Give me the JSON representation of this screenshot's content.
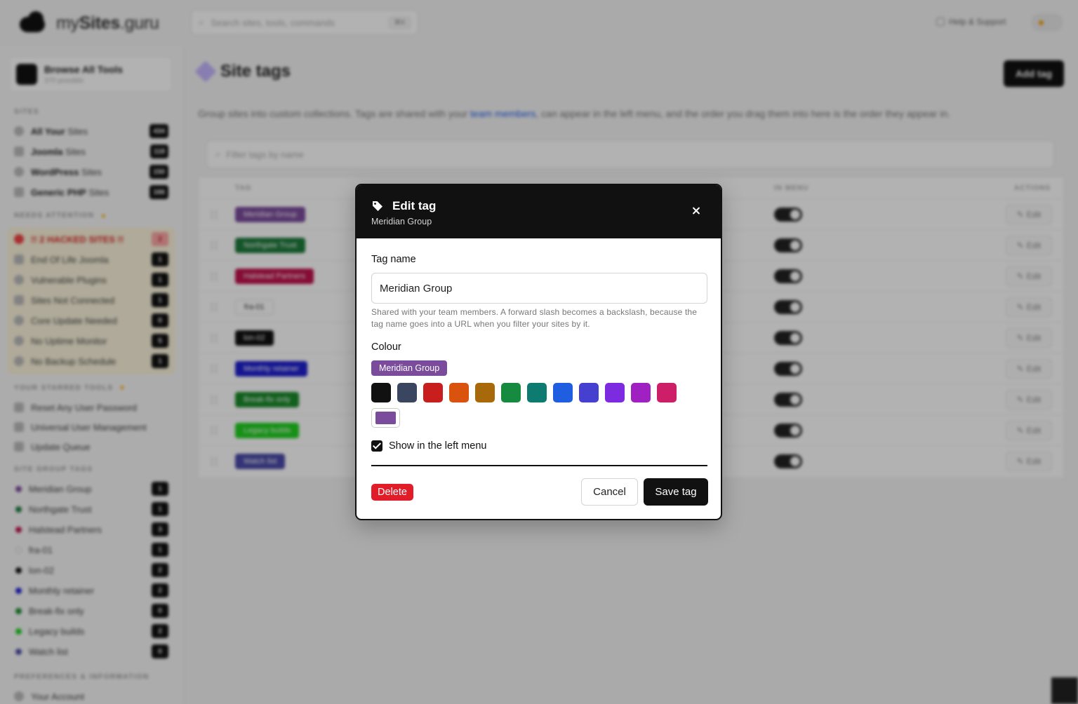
{
  "app": {
    "logo_text_light": "my",
    "logo_text_bold": "Sites",
    "logo_text_tail": ".guru",
    "search_placeholder": "Search sites, tools, commands",
    "search_kbd": "⌘K",
    "help_label": "Help & Support"
  },
  "sidebar": {
    "browse_title": "Browse All Tools",
    "browse_sub": "370 possible",
    "sites_label": "SITES",
    "sites": [
      {
        "bold": "All Your",
        "rest": " Sites",
        "count": "434"
      },
      {
        "bold": "Joomla",
        "rest": " Sites",
        "count": "118"
      },
      {
        "bold": "WordPress",
        "rest": " Sites",
        "count": "150"
      },
      {
        "bold": "Generic PHP",
        "rest": " Sites",
        "count": "166"
      }
    ],
    "attention_label": "NEEDS ATTENTION",
    "attention": [
      {
        "label": "!! 2 HACKED SITES !!",
        "count": "2"
      },
      {
        "label": "End Of Life Joomla",
        "count": "1"
      },
      {
        "label": "Vulnerable Plugins",
        "count": "1"
      },
      {
        "label": "Sites Not Connected",
        "count": "1"
      },
      {
        "label": "Core Update Needed",
        "count": "0"
      },
      {
        "label": "No Uptime Monitor",
        "count": "5"
      },
      {
        "label": "No Backup Schedule",
        "count": "1"
      }
    ],
    "starred_label": "YOUR STARRED TOOLS",
    "starred": [
      "Reset Any User Password",
      "Universal User Management",
      "Update Queue"
    ],
    "groups_label": "SITE GROUP TAGS",
    "groups": [
      {
        "label": "Meridian Group",
        "count": "1",
        "color": "#7b4c9c"
      },
      {
        "label": "Northgate Trust",
        "count": "1",
        "color": "#1e7a3c"
      },
      {
        "label": "Halstead Partners",
        "count": "3",
        "color": "#c0134d"
      },
      {
        "label": "fra-01",
        "count": "1",
        "color": "#ffffff"
      },
      {
        "label": "lon-02",
        "count": "2",
        "color": "#111111"
      },
      {
        "label": "Monthly retainer",
        "count": "2",
        "color": "#2020d0"
      },
      {
        "label": "Break-fix only",
        "count": "0",
        "color": "#1a8a2a"
      },
      {
        "label": "Legacy builds",
        "count": "2",
        "color": "#20d020"
      },
      {
        "label": "Watch list",
        "count": "0",
        "color": "#4a4aa8"
      }
    ],
    "prefs_label": "PREFERENCES & INFORMATION",
    "account_label": "Your Account"
  },
  "main": {
    "title": "Site tags",
    "add_button": "Add tag",
    "desc_before": "Group sites into custom collections. Tags are shared with your ",
    "desc_link": "team members",
    "desc_after": ", can appear in the left menu, and the order you drag them into here is the order they appear in.",
    "filter_placeholder": "Filter tags by name",
    "col_tag": "TAG",
    "col_menu": "IN MENU",
    "col_actions": "ACTIONS",
    "edit_label": "Edit",
    "rows": [
      {
        "label": "Meridian Group",
        "color": "#7b4c9c"
      },
      {
        "label": "Northgate Trust",
        "color": "#1e7a3c"
      },
      {
        "label": "Halstead Partners",
        "color": "#c0134d"
      },
      {
        "label": "fra-01",
        "color": "#ffffff"
      },
      {
        "label": "lon-02",
        "color": "#111111"
      },
      {
        "label": "Monthly retainer",
        "color": "#2020d0"
      },
      {
        "label": "Break-fix only",
        "color": "#1a8a2a"
      },
      {
        "label": "Legacy builds",
        "color": "#20d020"
      },
      {
        "label": "Watch list",
        "color": "#4a4aa8"
      }
    ]
  },
  "modal": {
    "title": "Edit tag",
    "subtitle": "Meridian Group",
    "name_label": "Tag name",
    "name_value": "Meridian Group",
    "hint": "Shared with your team members. A forward slash becomes a backslash, because the tag name goes into a URL when you filter your sites by it.",
    "colour_label": "Colour",
    "preview_label": "Meridian Group",
    "selected_color": "#7b4c9c",
    "swatches": [
      "#111111",
      "#3a4560",
      "#c81e1e",
      "#d9530f",
      "#a8690a",
      "#168a3e",
      "#0e7b70",
      "#1f5ee0",
      "#4540cf",
      "#7c2be0",
      "#a021c2",
      "#cc1f68"
    ],
    "show_in_menu_label": "Show in the left menu",
    "show_in_menu": true,
    "delete_label": "Delete",
    "cancel_label": "Cancel",
    "save_label": "Save tag"
  }
}
